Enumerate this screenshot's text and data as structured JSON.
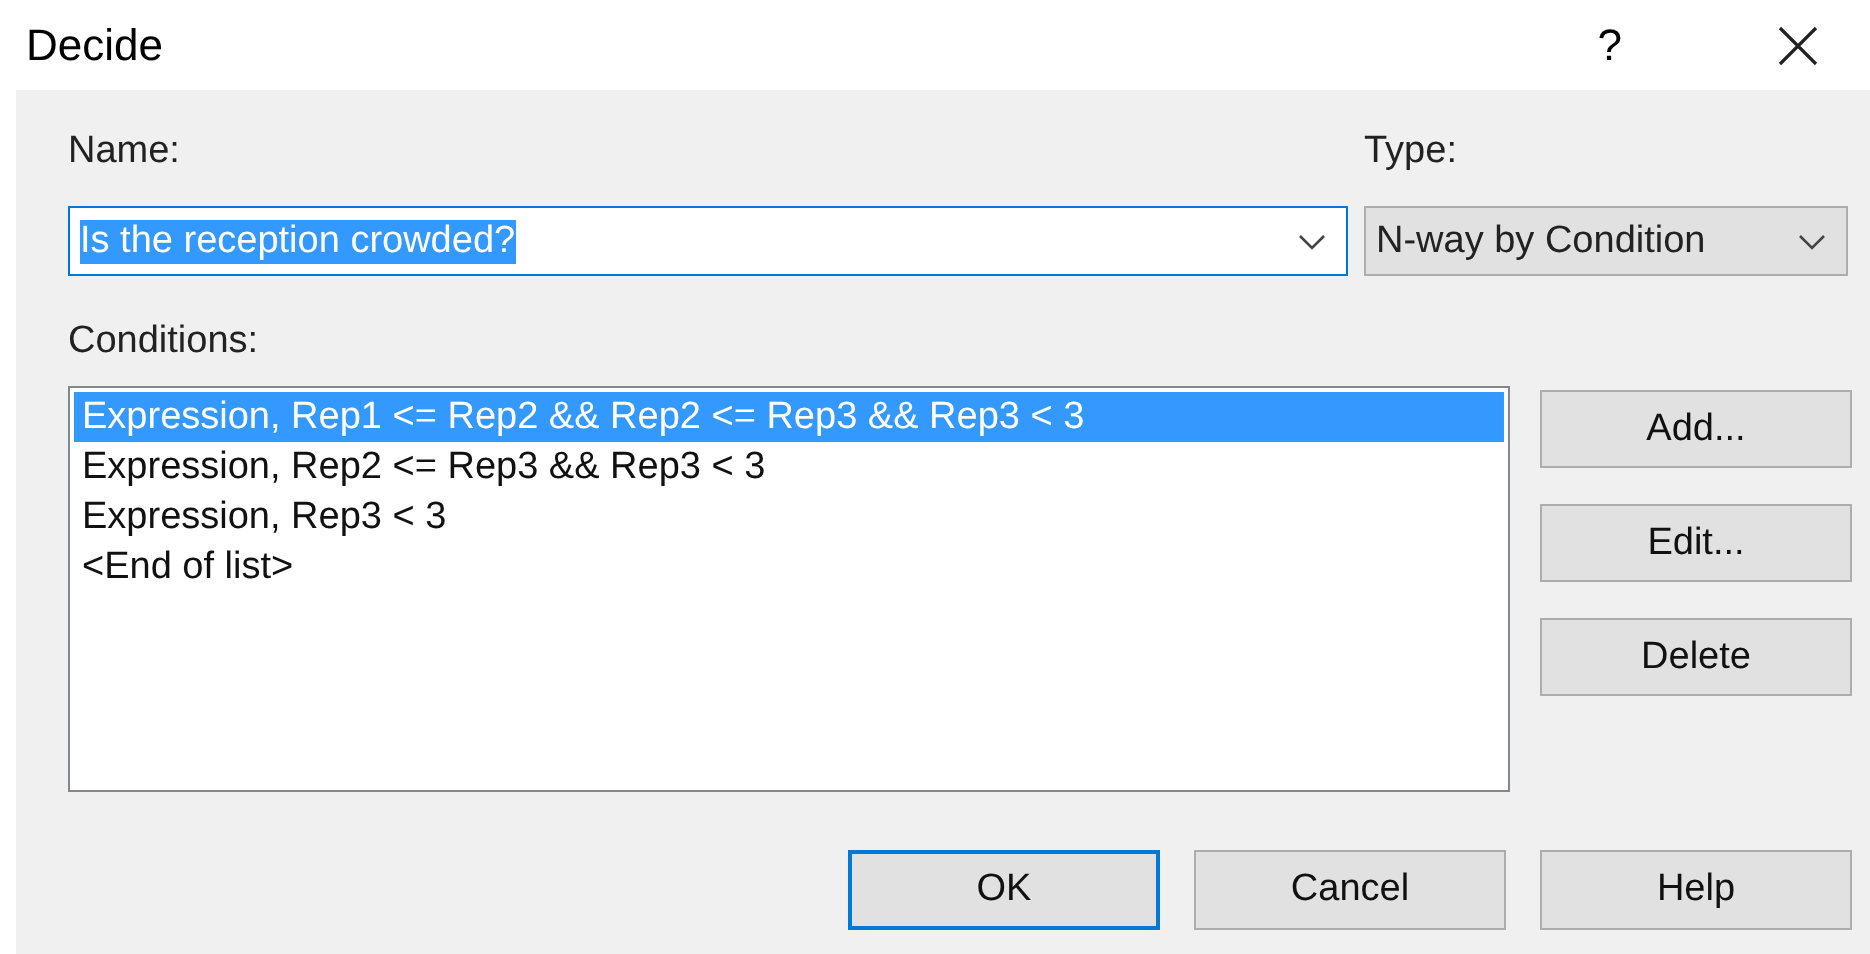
{
  "window": {
    "title": "Decide",
    "help_button": "?"
  },
  "name_field": {
    "label": "Name:",
    "value": "Is the reception crowded?",
    "text_selected": true
  },
  "type_field": {
    "label": "Type:",
    "value": "N-way by Condition"
  },
  "conditions": {
    "label": "Conditions:",
    "items": [
      {
        "text": "Expression, Rep1 <= Rep2 && Rep2 <= Rep3 && Rep3 < 3",
        "selected": true
      },
      {
        "text": "Expression, Rep2 <= Rep3 && Rep3 < 3",
        "selected": false
      },
      {
        "text": "Expression, Rep3 < 3",
        "selected": false
      },
      {
        "text": "<End of list>",
        "selected": false
      }
    ]
  },
  "side_buttons": [
    {
      "label": "Add..."
    },
    {
      "label": "Edit..."
    },
    {
      "label": "Delete"
    }
  ],
  "buttons": [
    {
      "label": "OK",
      "default": true
    },
    {
      "label": "Cancel",
      "default": false
    },
    {
      "label": "Help",
      "default": false
    }
  ]
}
